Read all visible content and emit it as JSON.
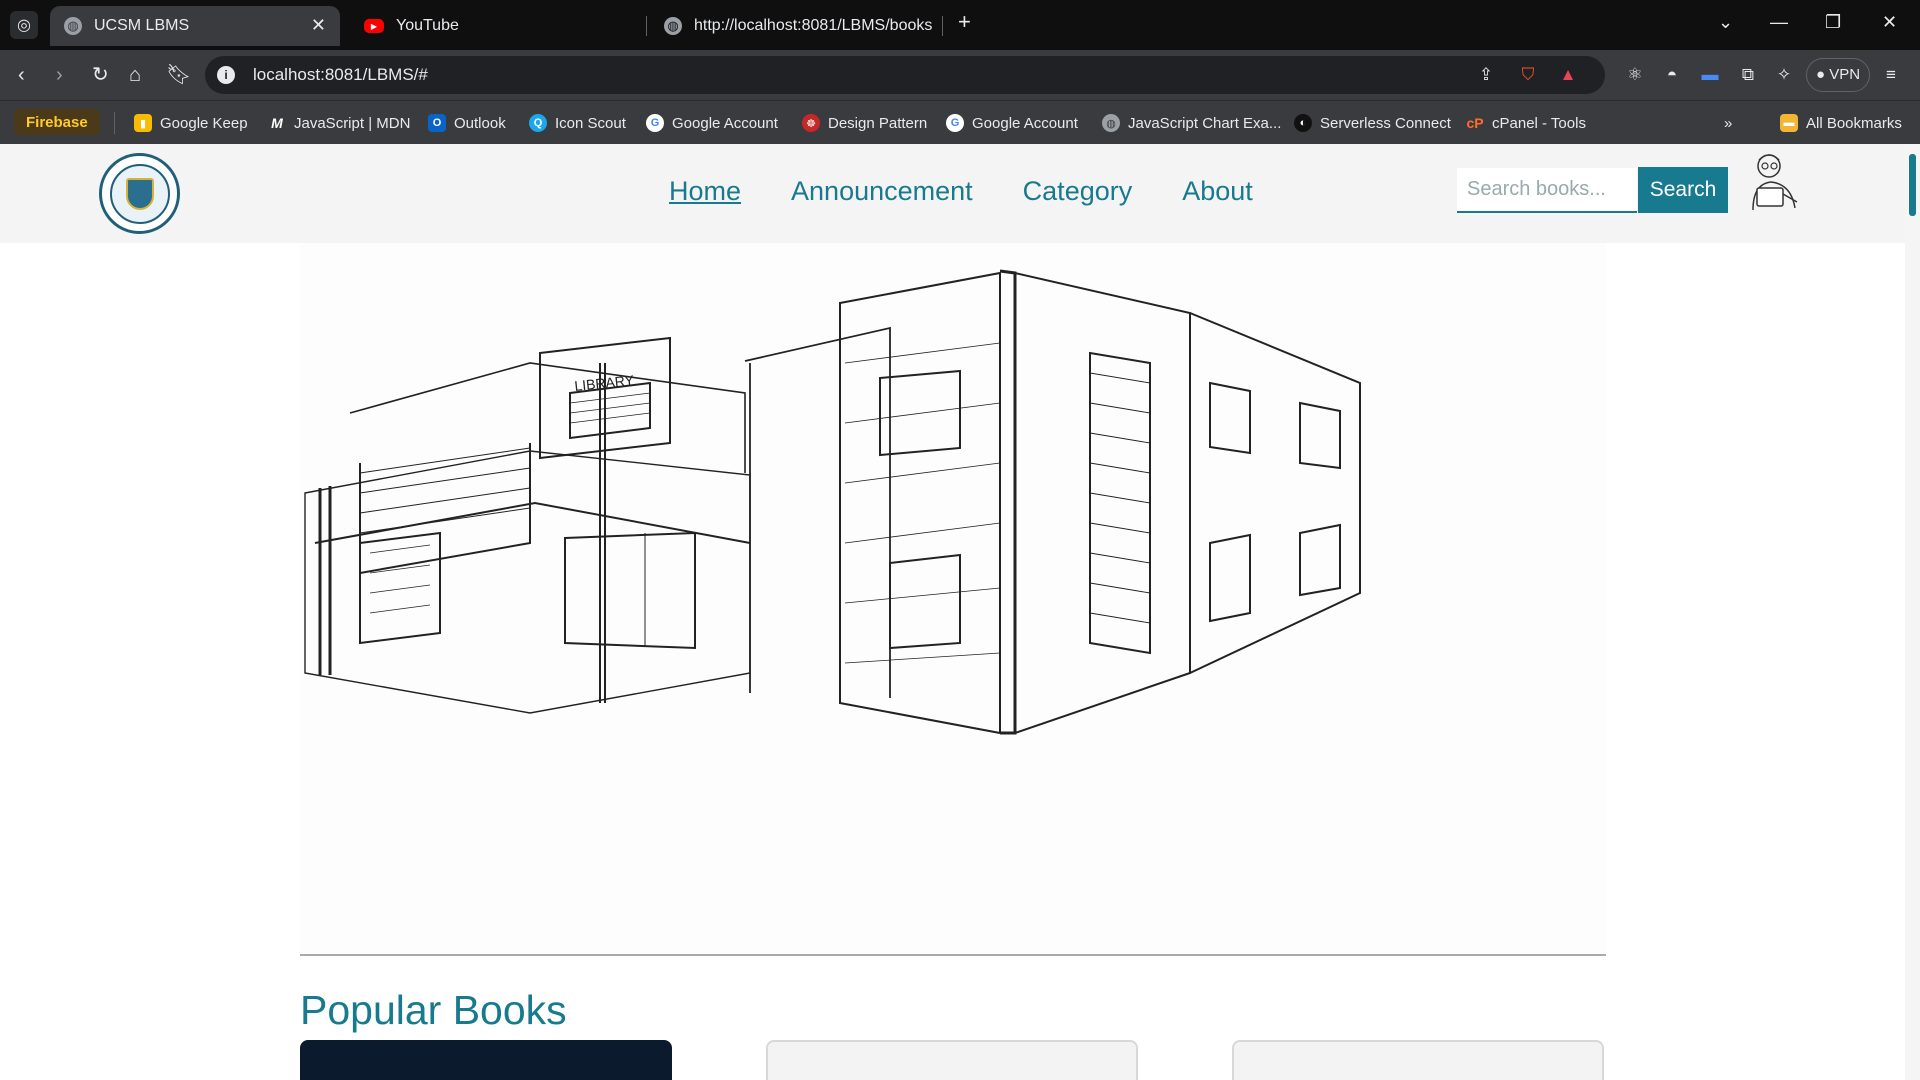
{
  "browser": {
    "tabs": [
      {
        "label": "UCSM LBMS",
        "icon": "globe-icon"
      },
      {
        "label": "YouTube",
        "icon": "youtube-icon"
      },
      {
        "label": "http://localhost:8081/LBMS/books",
        "icon": "globe-icon"
      }
    ],
    "address": "localhost:8081/LBMS/#",
    "vpn_label": "VPN",
    "bookmarks": [
      {
        "label": "Firebase"
      },
      {
        "label": "Google Keep"
      },
      {
        "label": "JavaScript | MDN"
      },
      {
        "label": "Outlook"
      },
      {
        "label": "Icon Scout"
      },
      {
        "label": "Google Account"
      },
      {
        "label": "Design Pattern"
      },
      {
        "label": "Google Account"
      },
      {
        "label": "JavaScript Chart Exa..."
      },
      {
        "label": "Serverless Connect"
      },
      {
        "label": "cPanel - Tools"
      }
    ],
    "all_bookmarks": "All Bookmarks"
  },
  "site": {
    "nav": [
      "Home",
      "Announcement",
      "Category",
      "About"
    ],
    "search_placeholder": "Search books...",
    "search_label": "Search",
    "sketch_sign": "LIBRARY",
    "section_title": "Popular Books",
    "accent": "#187a8e"
  }
}
